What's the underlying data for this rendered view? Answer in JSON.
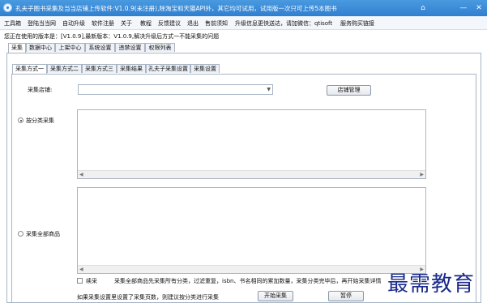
{
  "window": {
    "title": "孔夫子图书采集及当当店铺上传软件:V1.0.9(未注册),除淘宝和天猫API外，其它均可试用，试用版一次只可上传5本图书",
    "home_icon": "home-icon",
    "minimize": "—",
    "close": "✕"
  },
  "menu": [
    "工具箱",
    "登陆当当网",
    "自动升级",
    "软件注册",
    "关于",
    "教程",
    "反馈建议",
    "退出",
    "售前须知",
    "升级信息更快送达，请加微信：qtisoft",
    "服务购买链接"
  ],
  "notice": "您正在使用的版本是：[V1.0.9],最新版本：V1.0.9,解决升级后方式一不能采集的问题",
  "main_tabs": [
    "采集",
    "数据中心",
    "上架中心",
    "系统设置",
    "违禁设置",
    "权限列表"
  ],
  "sub_tabs": [
    "采集方式一",
    "采集方式二",
    "采集方式三",
    "采集结果",
    "孔夫子采集设置",
    "采集设置"
  ],
  "store": {
    "label": "采集店铺:",
    "value": "",
    "manage_button": "店铺管理"
  },
  "options": {
    "by_category": "按分类采集",
    "all_products": "采集全部商品"
  },
  "bottom": {
    "continue_label": "续采",
    "info": "采集全部商品先采集所有分类，过滤重复，isbn、书名相同的累加数量，采集分类完毕后，再开始采集详情",
    "hint": "如果采集设置里设置了采集页数，则建议按分类进行采集",
    "start_button": "开始采集",
    "pause_button": "暂停"
  },
  "watermark": "最需教育",
  "colors": {
    "titlebar": "#2f7fd0",
    "watermark": "#1a2a8a"
  }
}
